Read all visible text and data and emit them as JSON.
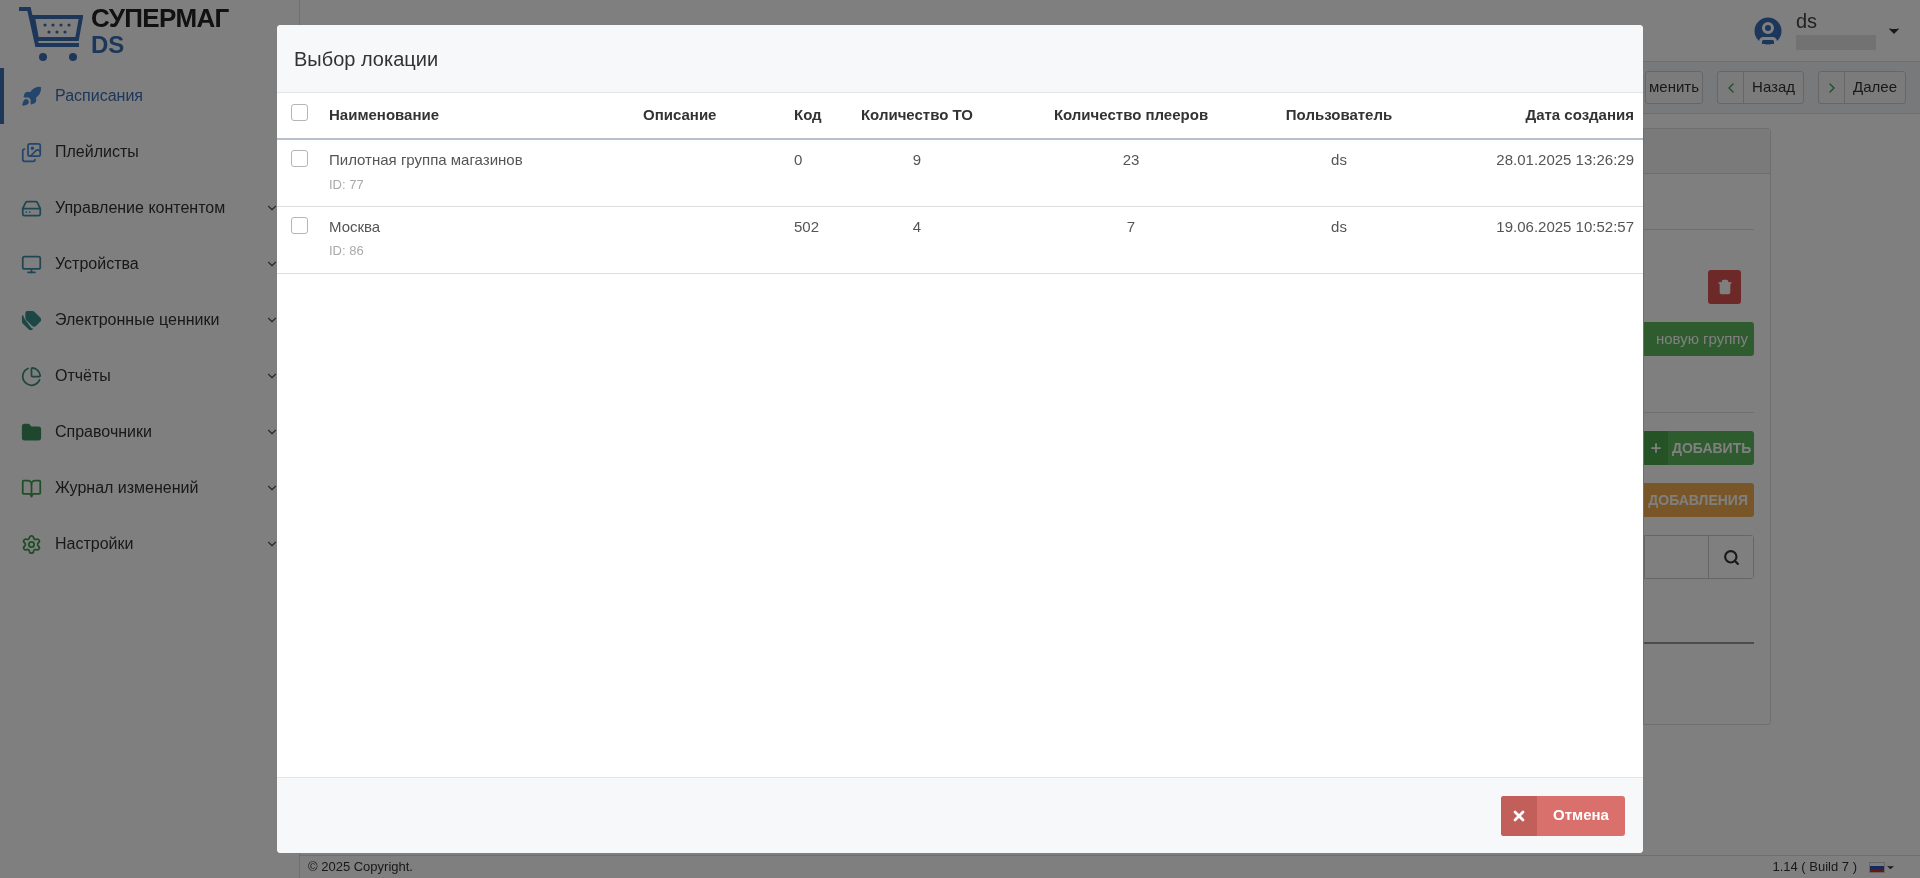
{
  "logo": {
    "name": "СУПЕРМАГ",
    "suffix": "DS"
  },
  "sidebar": {
    "items": [
      {
        "label": "Расписания",
        "selected": true,
        "has_submenu": false
      },
      {
        "label": "Плейлисты",
        "selected": false,
        "has_submenu": false
      },
      {
        "label": "Управление контентом",
        "selected": false,
        "has_submenu": true
      },
      {
        "label": "Устройства",
        "selected": false,
        "has_submenu": true
      },
      {
        "label": "Электронные ценники",
        "selected": false,
        "has_submenu": true
      },
      {
        "label": "Отчёты",
        "selected": false,
        "has_submenu": true
      },
      {
        "label": "Справочники",
        "selected": false,
        "has_submenu": true
      },
      {
        "label": "Журнал изменений",
        "selected": false,
        "has_submenu": true
      },
      {
        "label": "Настройки",
        "selected": false,
        "has_submenu": true
      }
    ]
  },
  "user": {
    "name": "ds"
  },
  "toolbar": {
    "buttons": [
      {
        "label": "менить",
        "kind": "plain"
      },
      {
        "label": "Назад",
        "kind": "back"
      },
      {
        "label": "Далее",
        "kind": "next"
      }
    ]
  },
  "panel": {
    "group_button": "новую группу",
    "add_button": "ДОБАВИТЬ",
    "yellow_button": "ДОБАВЛЕНИЯ"
  },
  "footer": {
    "copyright": "© 2025 Copyright.",
    "version": "1.14 ( Build 7 )"
  },
  "modal": {
    "title": "Выбор локации",
    "select_all_checked": false,
    "columns": [
      "Наименование",
      "Описание",
      "Код",
      "Количество ТО",
      "Количество плееров",
      "Пользователь",
      "Дата создания"
    ],
    "rows": [
      {
        "checked": false,
        "name": "Пилотная группа магазинов",
        "id": "ID: 77",
        "code": "0",
        "to_count": "9",
        "players": "23",
        "user": "ds",
        "created": "28.01.2025 13:26:29"
      },
      {
        "checked": false,
        "name": "Москва",
        "id": "ID: 86",
        "code": "502",
        "to_count": "4",
        "players": "7",
        "user": "ds",
        "created": "19.06.2025 10:52:57"
      }
    ],
    "cancel": "Отмена"
  }
}
